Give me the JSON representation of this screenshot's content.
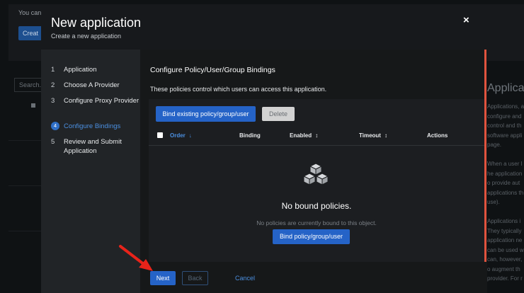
{
  "background": {
    "notice_text": "You can",
    "create_label": "Creat",
    "search_placeholder": "Search...",
    "side_heading": "Applicati",
    "side_text": [
      "Applications, a",
      "configure and",
      "control and th",
      "software appli",
      "page.",
      "",
      "When a user l",
      "he application",
      "o provide aut",
      "applications th",
      "use).",
      "",
      "Applications i",
      "They typically",
      "application ne",
      "can be used w",
      "can, however,",
      "o augment th",
      "provider. For r"
    ]
  },
  "modal": {
    "title": "New application",
    "subtitle": "Create a new application",
    "close_label": "×",
    "steps": [
      {
        "num": "1",
        "label": "Application"
      },
      {
        "num": "2",
        "label": "Choose A Provider"
      },
      {
        "num": "3",
        "label": "Configure Proxy Provider"
      },
      {
        "num": "4",
        "label": "Configure Bindings"
      },
      {
        "num": "5",
        "label": "Review and Submit Application"
      }
    ],
    "current_step": 4,
    "section_title": "Configure Policy/User/Group Bindings",
    "section_description": "These policies control which users can access this application.",
    "bind_existing_label": "Bind existing policy/group/user",
    "delete_label": "Delete",
    "columns": [
      "Order",
      "Binding",
      "Enabled",
      "Timeout",
      "Actions"
    ],
    "empty_title": "No bound policies.",
    "empty_body": "No policies are currently bound to this object.",
    "bind_new_label": "Bind policy/group/user",
    "next_label": "Next",
    "back_label": "Back",
    "cancel_label": "Cancel"
  },
  "colors": {
    "accent": "#2563c7",
    "link": "#4b8fe0",
    "annotation_arrow": "#e8231a",
    "scroll_indicator": "#e0533e"
  },
  "icons": {
    "close": "close-icon",
    "sort": "sort-icon",
    "empty_state": "cubes-icon"
  }
}
